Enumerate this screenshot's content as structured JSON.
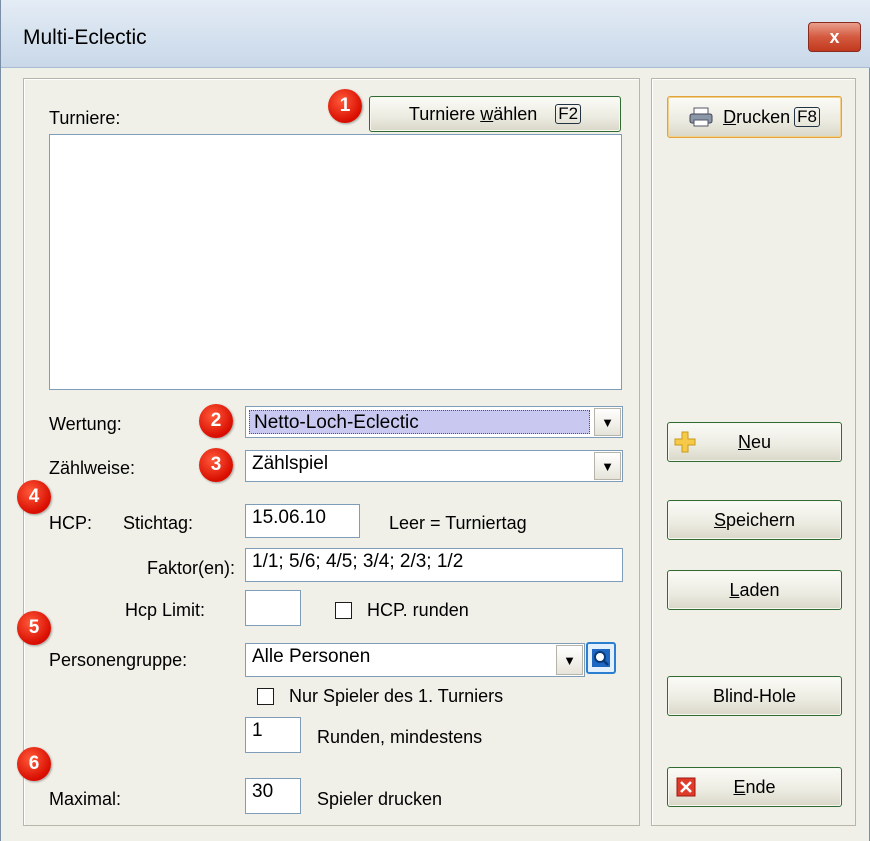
{
  "window": {
    "title": "Multi-Eclectic",
    "close_label": "x"
  },
  "turniere": {
    "label": "Turniere:",
    "choose_button": {
      "pre": "Turniere ",
      "underlined": "w",
      "post": "ählen",
      "shortcut": "F2"
    }
  },
  "wertung": {
    "label": "Wertung:",
    "value": "Netto-Loch-Eclectic"
  },
  "zaehlweise": {
    "label": "Zählweise:",
    "value": "Zählspiel"
  },
  "hcp": {
    "label": "HCP:",
    "stichtag_label": "Stichtag:",
    "stichtag_value": "15.06.10",
    "stichtag_hint": "Leer = Turniertag",
    "faktor_label": "Faktor(en):",
    "faktor_value": "1/1; 5/6; 4/5; 3/4; 2/3; 1/2",
    "limit_label": "Hcp Limit:",
    "limit_value": "",
    "runden_label": "HCP. runden"
  },
  "personengruppe": {
    "label": "Personengruppe:",
    "value": "Alle Personen",
    "nur_spieler_label": "Nur Spieler des 1. Turniers",
    "runden_value": "1",
    "runden_label": "Runden, mindestens"
  },
  "maximal": {
    "label": "Maximal:",
    "value": "30",
    "suffix": "Spieler drucken"
  },
  "side_buttons": {
    "drucken": {
      "underlined": "D",
      "rest": "rucken",
      "shortcut": "F8"
    },
    "neu": {
      "underlined": "N",
      "rest": "eu"
    },
    "speichern": {
      "underlined": "S",
      "rest": "peichern"
    },
    "laden": {
      "underlined": "L",
      "rest": "aden"
    },
    "blind_hole": "Blind-Hole",
    "ende": {
      "underlined": "E",
      "rest": "nde"
    }
  },
  "badges": [
    "1",
    "2",
    "3",
    "4",
    "5",
    "6"
  ],
  "colors": {
    "selection": "#c8c8f0",
    "badge_red": "#e0190a",
    "accent_green": "#2f6b33",
    "button_focus": "#e3a33b"
  },
  "icons": {
    "drucken": "printer-icon",
    "neu": "plus-icon",
    "ende": "exit-icon",
    "personengruppe": "search-icon"
  }
}
